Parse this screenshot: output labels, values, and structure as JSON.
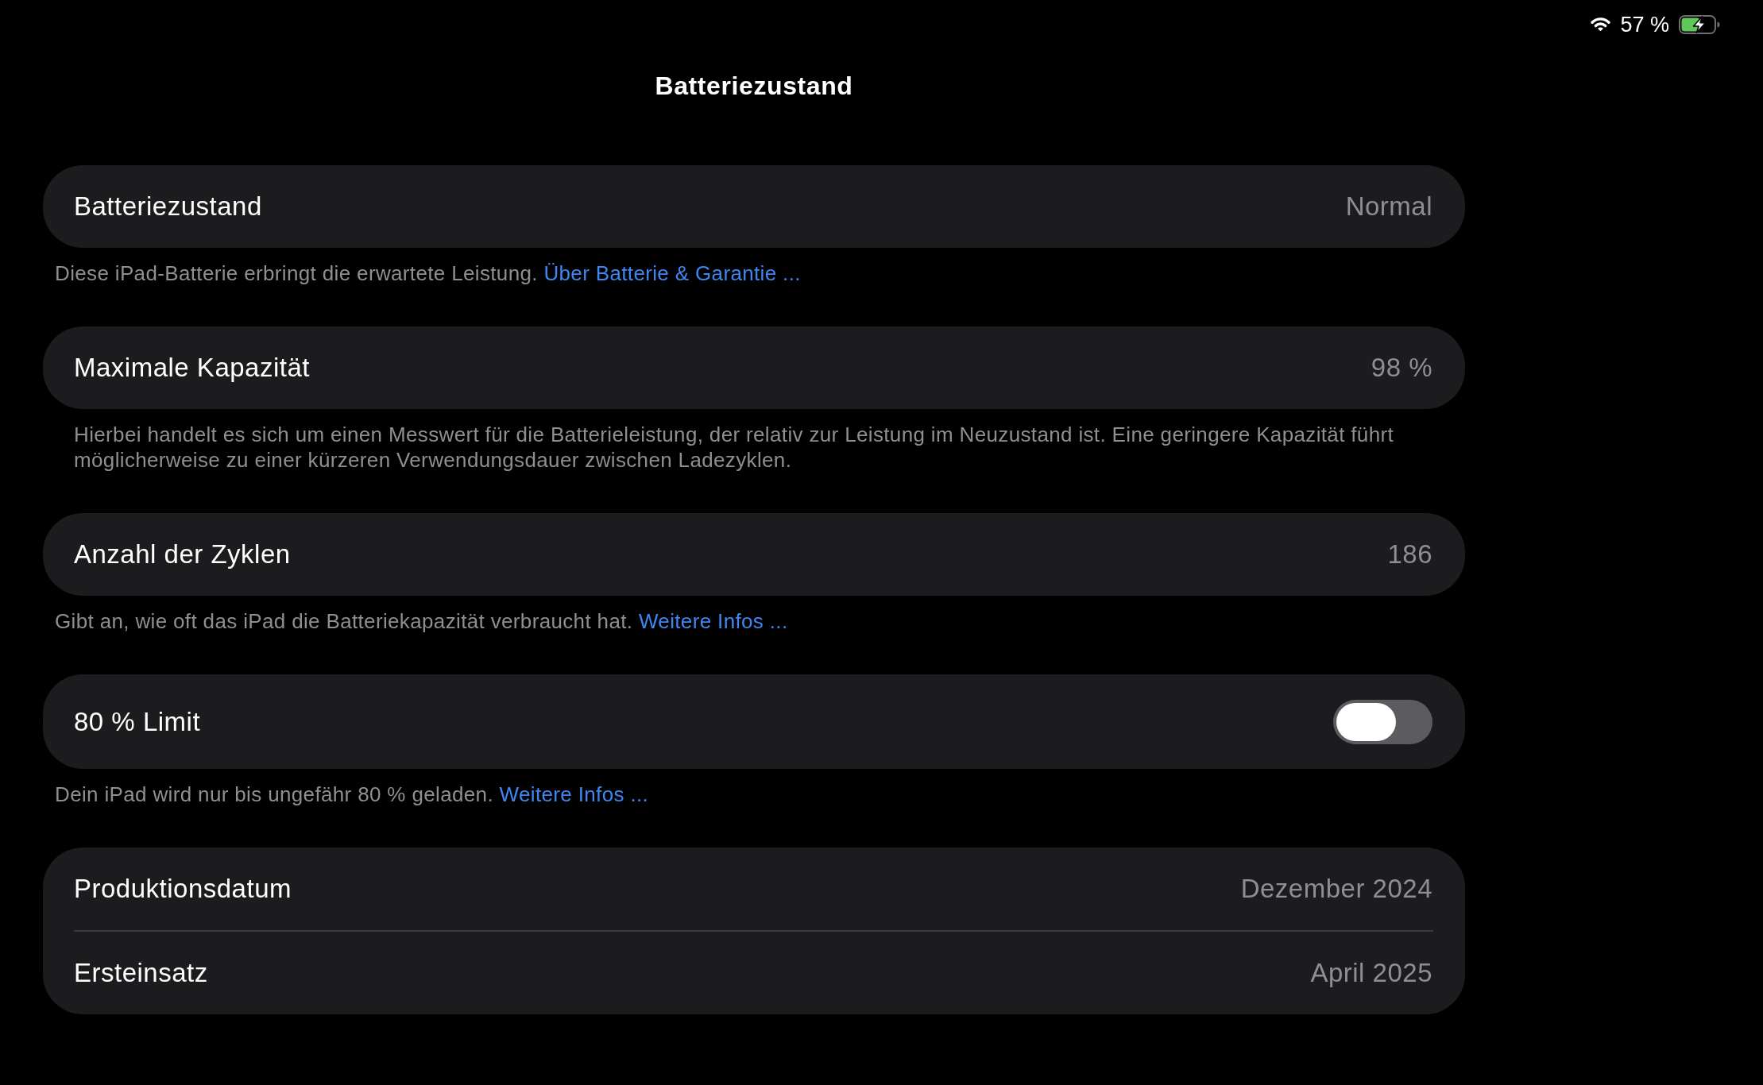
{
  "status_bar": {
    "battery_percent": "57 %"
  },
  "navigation_bar": {
    "title": "Batteriezustand"
  },
  "sections": [
    {
      "rows": [
        {
          "kind": "value",
          "label": "Batteriezustand",
          "value": "Normal"
        }
      ],
      "footer": {
        "text": "Diese iPad-Batterie erbringt die erwartete Leistung.",
        "link": "Über Batterie & Garantie ..."
      }
    },
    {
      "rows": [
        {
          "kind": "value",
          "label": "Maximale Kapazität",
          "value": "98 %"
        }
      ],
      "footer": {
        "text": "Hierbei handelt es sich um einen Messwert für die Batterieleistung, der relativ zur Leistung im Neuzustand ist. Eine geringere Kapazität führt möglicherweise zu einer kürzeren Verwendungsdauer zwischen Ladezyklen."
      }
    },
    {
      "rows": [
        {
          "kind": "value",
          "label": "Anzahl der Zyklen",
          "value": "186"
        }
      ],
      "footer": {
        "text": "Gibt an, wie oft das iPad die Batteriekapazität verbraucht hat.",
        "link": "Weitere Infos ..."
      }
    },
    {
      "rows": [
        {
          "kind": "toggle",
          "label": "80 % Limit",
          "on": false
        }
      ],
      "footer": {
        "text": "Dein iPad wird nur bis ungefähr 80 % geladen.",
        "link": "Weitere Infos ..."
      }
    },
    {
      "rows": [
        {
          "kind": "value",
          "label": "Produktionsdatum",
          "value": "Dezember 2024"
        },
        {
          "kind": "value",
          "label": "Ersteinsatz",
          "value": "April 2025"
        }
      ]
    }
  ]
}
